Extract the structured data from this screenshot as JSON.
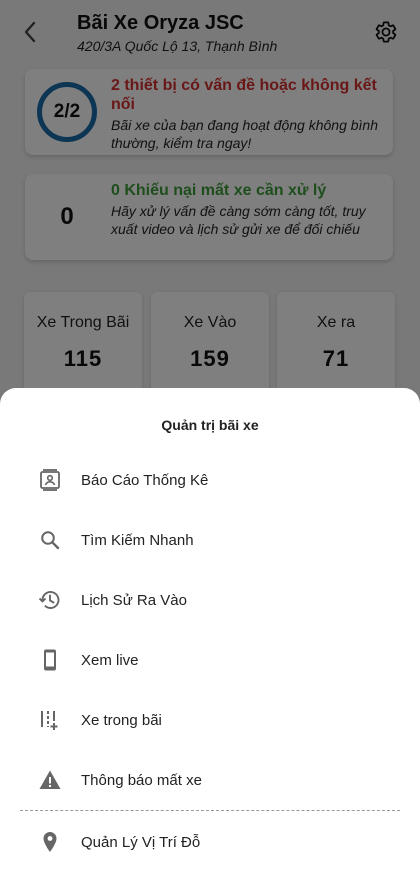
{
  "header": {
    "title": "Bãi Xe Oryza JSC",
    "address": "420/3A Quốc Lộ 13, Thạnh Bình"
  },
  "issues_card": {
    "ratio": "2/2",
    "heading": "2 thiết bị có vấn đề hoặc không kết nối",
    "description": "Bãi xe của bạn đang hoạt động không bình thường, kiểm tra ngay!"
  },
  "complaints_card": {
    "count": "0",
    "heading": "0 Khiếu nại mất xe cần xử lý",
    "description": "Hãy xử lý vấn đề càng sớm càng tốt, truy xuất video và lịch sử gửi xe để đối chiếu"
  },
  "stats": [
    {
      "label": "Xe Trong Bãi",
      "value": "115"
    },
    {
      "label": "Xe Vào",
      "value": "159"
    },
    {
      "label": "Xe ra",
      "value": "71"
    }
  ],
  "sheet": {
    "title": "Quản trị bãi xe",
    "items": [
      {
        "label": "Báo Cáo Thống Kê",
        "icon": "report-icon"
      },
      {
        "label": "Tìm Kiếm Nhanh",
        "icon": "search-icon"
      },
      {
        "label": "Lịch Sử Ra Vào",
        "icon": "history-icon"
      },
      {
        "label": "Xem live",
        "icon": "phone-icon"
      },
      {
        "label": "Xe trong bãi",
        "icon": "parking-slots-icon"
      },
      {
        "label": "Thông báo mất xe",
        "icon": "warning-icon"
      },
      {
        "label": "Quản Lý Vị Trí Đỗ",
        "icon": "location-pin-icon"
      }
    ]
  },
  "colors": {
    "ring": "#1a6aa8",
    "alert_red": "#d32f2f",
    "ok_green": "#3f9d3a",
    "overlay": "rgba(0,0,0,0.5)"
  }
}
